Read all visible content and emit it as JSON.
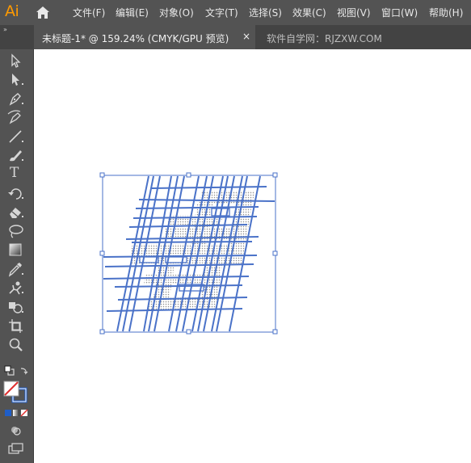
{
  "app": {
    "logo": "Ai"
  },
  "menu": {
    "items": [
      {
        "label": "文件(F)"
      },
      {
        "label": "编辑(E)"
      },
      {
        "label": "对象(O)"
      },
      {
        "label": "文字(T)"
      },
      {
        "label": "选择(S)"
      },
      {
        "label": "效果(C)"
      },
      {
        "label": "视图(V)"
      },
      {
        "label": "窗口(W)"
      },
      {
        "label": "帮助(H)"
      }
    ]
  },
  "tabs": {
    "active_title": "未标题-1* @ 159.24% (CMYK/GPU 预览)",
    "close_glyph": "×",
    "inactive_title": "软件自学网：RJZXW.COM"
  },
  "toolbar": {
    "collapse_glyph": "»",
    "tools": [
      {
        "icon": "selection-tool-icon"
      },
      {
        "icon": "direct-selection-tool-icon"
      },
      {
        "icon": "pen-tool-icon"
      },
      {
        "icon": "curvature-tool-icon"
      },
      {
        "icon": "line-segment-tool-icon"
      },
      {
        "icon": "paintbrush-tool-icon"
      },
      {
        "icon": "type-tool-icon"
      },
      {
        "icon": "rotate-tool-icon"
      },
      {
        "icon": "eraser-tool-icon"
      },
      {
        "icon": "lasso-tool-icon"
      },
      {
        "icon": "gradient-tool-icon"
      },
      {
        "icon": "eyedropper-tool-icon"
      },
      {
        "icon": "puppet-warp-tool-icon"
      },
      {
        "icon": "shape-builder-tool-icon"
      },
      {
        "icon": "artboard-tool-icon"
      },
      {
        "icon": "zoom-tool-icon"
      }
    ],
    "type_glyph": "T"
  },
  "colors": {
    "menubar": "#535353",
    "tabbar": "#434343",
    "toolbar": "#535353",
    "canvas": "#ffffff",
    "logo": "#ff9a00",
    "line_art": "#4a72c8",
    "selection": "#4a72c8",
    "stroke_swatch": "#1f5ec8",
    "none_slash": "#e03030"
  }
}
